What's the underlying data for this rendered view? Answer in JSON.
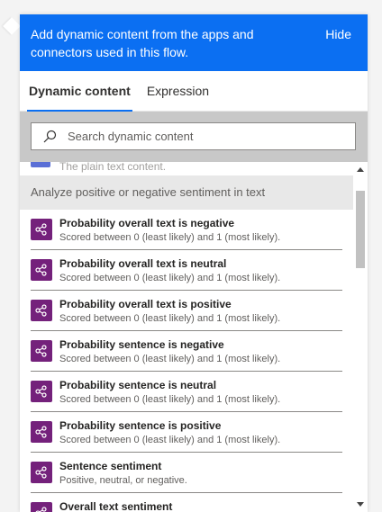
{
  "banner": {
    "text": "Add dynamic content from the apps and connectors used in this flow.",
    "hide_label": "Hide",
    "color": "#0b6ff2"
  },
  "tabs": [
    {
      "label": "Dynamic content",
      "active": true
    },
    {
      "label": "Expression",
      "active": false
    }
  ],
  "search": {
    "placeholder": "Search dynamic content",
    "value": ""
  },
  "list": {
    "cut_item_text": "The plain text content.",
    "section_header": "Analyze positive or negative sentiment in text",
    "items": [
      {
        "title": "Probability overall text is negative",
        "desc": "Scored between 0 (least likely) and 1 (most likely).",
        "icon": "ai-builder-icon"
      },
      {
        "title": "Probability overall text is neutral",
        "desc": "Scored between 0 (least likely) and 1 (most likely).",
        "icon": "ai-builder-icon"
      },
      {
        "title": "Probability overall text is positive",
        "desc": "Scored between 0 (least likely) and 1 (most likely).",
        "icon": "ai-builder-icon"
      },
      {
        "title": "Probability sentence is negative",
        "desc": "Scored between 0 (least likely) and 1 (most likely).",
        "icon": "ai-builder-icon"
      },
      {
        "title": "Probability sentence is neutral",
        "desc": "Scored between 0 (least likely) and 1 (most likely).",
        "icon": "ai-builder-icon"
      },
      {
        "title": "Probability sentence is positive",
        "desc": "Scored between 0 (least likely) and 1 (most likely).",
        "icon": "ai-builder-icon"
      },
      {
        "title": "Sentence sentiment",
        "desc": "Positive, neutral, or negative.",
        "icon": "ai-builder-icon"
      },
      {
        "title": "Overall text sentiment",
        "desc": "",
        "icon": "ai-builder-icon"
      }
    ]
  },
  "colors": {
    "accent": "#0b6ff2",
    "icon_bg": "#74217b"
  }
}
